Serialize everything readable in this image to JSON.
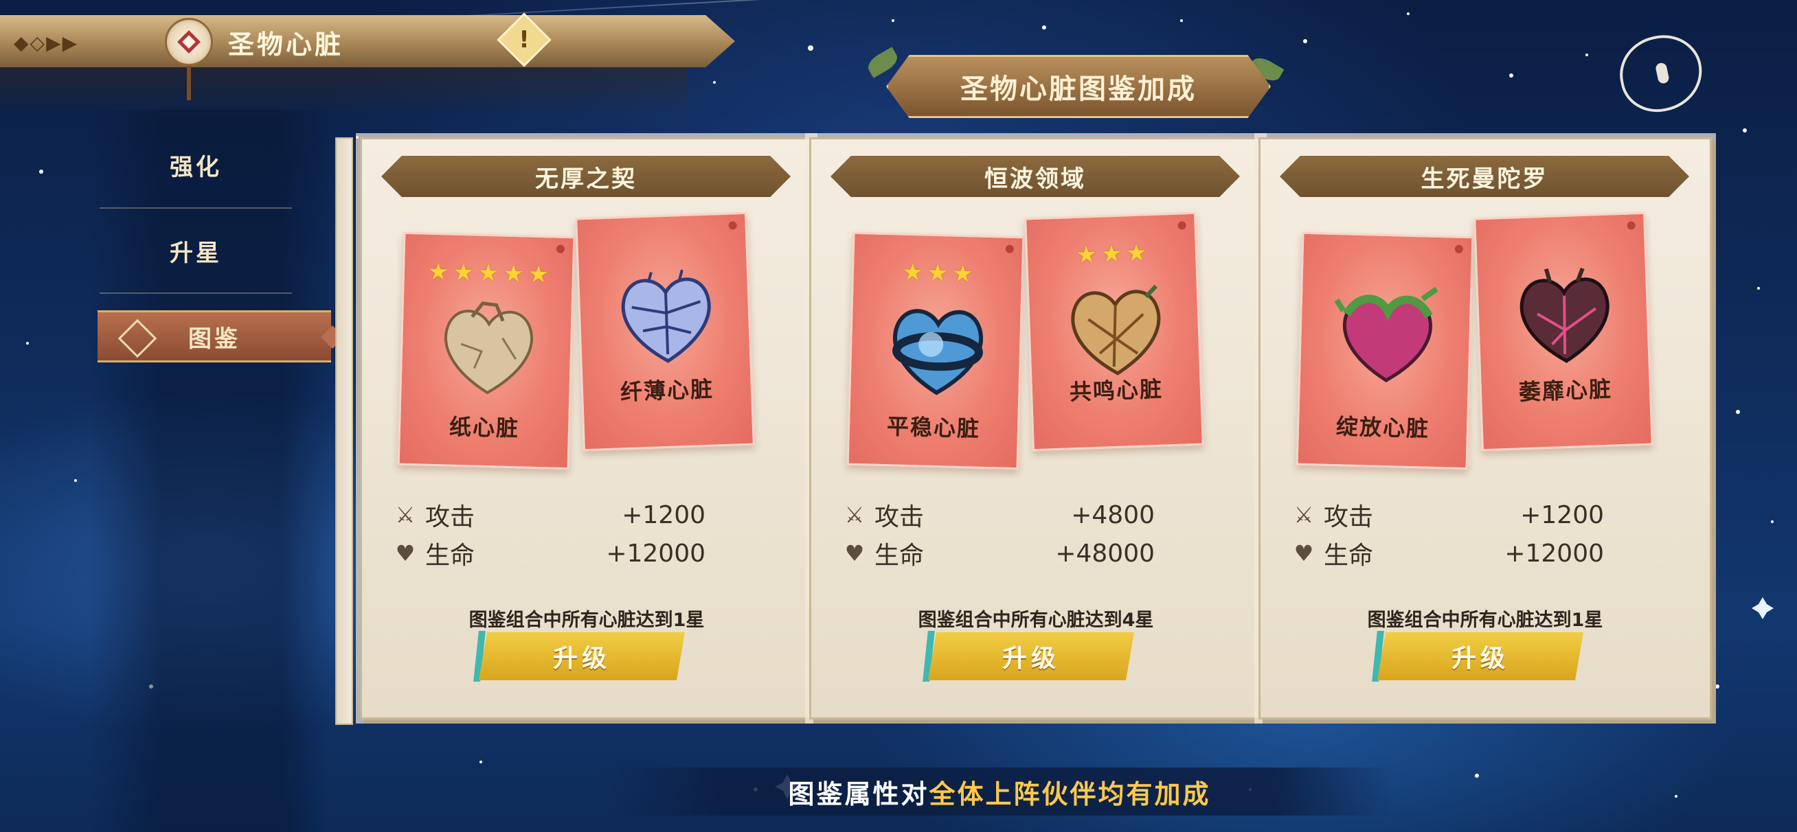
{
  "header": {
    "title": "圣物心脏",
    "alert_icon": "!"
  },
  "sidebar": {
    "items": [
      {
        "label": "强化",
        "active": false
      },
      {
        "label": "升星",
        "active": false
      },
      {
        "label": "图鉴",
        "active": true
      }
    ]
  },
  "section": {
    "title": "圣物心脏图鉴加成"
  },
  "cards": [
    {
      "title": "无厚之契",
      "hearts": [
        {
          "name": "纸心脏",
          "stars": 5,
          "icon": "paper-heart-icon",
          "color": "#d8c4a0"
        },
        {
          "name": "纤薄心脏",
          "stars": 0,
          "icon": "thin-heart-icon",
          "color": "#8fa0d8"
        }
      ],
      "stats": [
        {
          "icon": "sword-icon",
          "label": "攻击",
          "value": "+1200"
        },
        {
          "icon": "heart-icon",
          "label": "生命",
          "value": "+12000"
        }
      ],
      "requirement": "图鉴组合中所有心脏达到1星",
      "button": "升级"
    },
    {
      "title": "恒波领域",
      "hearts": [
        {
          "name": "平稳心脏",
          "stars": 3,
          "icon": "calm-heart-icon",
          "color": "#2f6ea8"
        },
        {
          "name": "共鸣心脏",
          "stars": 3,
          "icon": "resonance-heart-icon",
          "color": "#c99a5a"
        }
      ],
      "stats": [
        {
          "icon": "sword-icon",
          "label": "攻击",
          "value": "+4800"
        },
        {
          "icon": "heart-icon",
          "label": "生命",
          "value": "+48000"
        }
      ],
      "requirement": "图鉴组合中所有心脏达到4星",
      "button": "升级"
    },
    {
      "title": "生死曼陀罗",
      "hearts": [
        {
          "name": "绽放心脏",
          "stars": 0,
          "icon": "bloom-heart-icon",
          "color": "#c23a78"
        },
        {
          "name": "萎靡心脏",
          "stars": 0,
          "icon": "wither-heart-icon",
          "color": "#6e3140"
        }
      ],
      "stats": [
        {
          "icon": "sword-icon",
          "label": "攻击",
          "value": "+1200"
        },
        {
          "icon": "heart-icon",
          "label": "生命",
          "value": "+12000"
        }
      ],
      "requirement": "图鉴组合中所有心脏达到1星",
      "button": "升级"
    }
  ],
  "footer": {
    "part1": "图鉴属性对",
    "part2": "全体上阵伙伴均有加成"
  },
  "colors": {
    "card_red": "#ee7f70",
    "gold_button": "#e3b52a",
    "ribbon_brown": "#7c5a35",
    "highlight_text": "#ffc94a"
  }
}
